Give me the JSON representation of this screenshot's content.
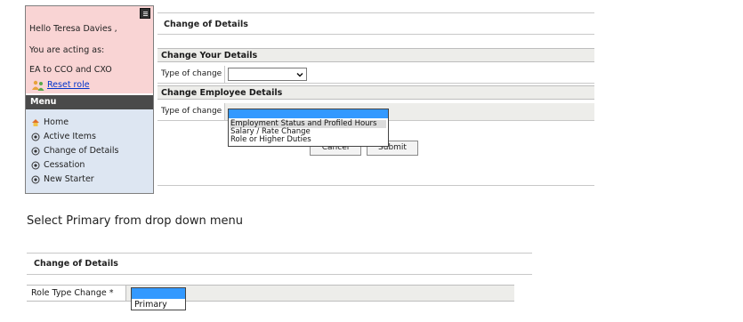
{
  "sidebar": {
    "greeting": "Hello Teresa Davies ,",
    "acting_as_label": "You are acting as:",
    "acting_as_value": "EA to CCO and CXO",
    "reset_role": "Reset role",
    "menu_title": "Menu",
    "menu_items": [
      {
        "label": "Home",
        "icon": "home-icon"
      },
      {
        "label": "Active Items",
        "icon": "circle-bullet-icon"
      },
      {
        "label": "Change of Details",
        "icon": "circle-bullet-icon"
      },
      {
        "label": "Cessation",
        "icon": "circle-bullet-icon"
      },
      {
        "label": "New Starter",
        "icon": "circle-bullet-icon"
      }
    ]
  },
  "main": {
    "page_title": "Change of Details",
    "section_your_details": "Change Your Details",
    "your_details_label": "Type of change",
    "your_details_value": "",
    "section_employee_details": "Change Employee Details",
    "employee_details_label": "Type of change",
    "employee_dropdown_options": [
      "Employment Status and Profiled Hours",
      "Salary / Rate Change",
      "Role or Higher Duties"
    ],
    "cancel_label": "Cancel",
    "submit_label": "Submit"
  },
  "instruction": "Select Primary from drop down menu",
  "bottom": {
    "page_title": "Change of Details",
    "role_type_label": "Role Type Change *",
    "dropdown_options": [
      "Primary"
    ]
  },
  "colors": {
    "user_panel_bg": "#f9d4d4",
    "menu_bg": "#dde6f2",
    "menu_header_bg": "#4a4a4a",
    "highlight": "#3399ff",
    "link": "#0033cc"
  }
}
